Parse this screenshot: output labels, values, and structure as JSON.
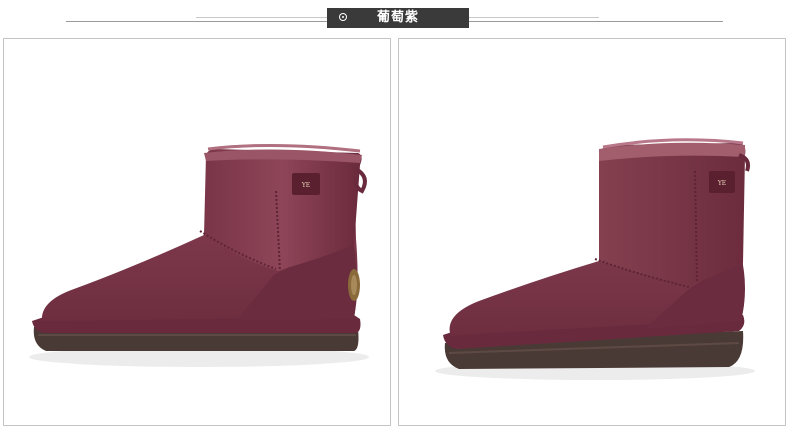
{
  "header": {
    "color_name": "葡萄紫",
    "icon": "target-circle-icon"
  },
  "product": {
    "color_hex": "#7a3546",
    "sole_hex": "#4a3a36",
    "trim_hex": "#6a2a3e",
    "views": [
      {
        "name": "side-view",
        "icon": "boot-side-image"
      },
      {
        "name": "angled-view",
        "icon": "boot-angled-image"
      }
    ]
  }
}
